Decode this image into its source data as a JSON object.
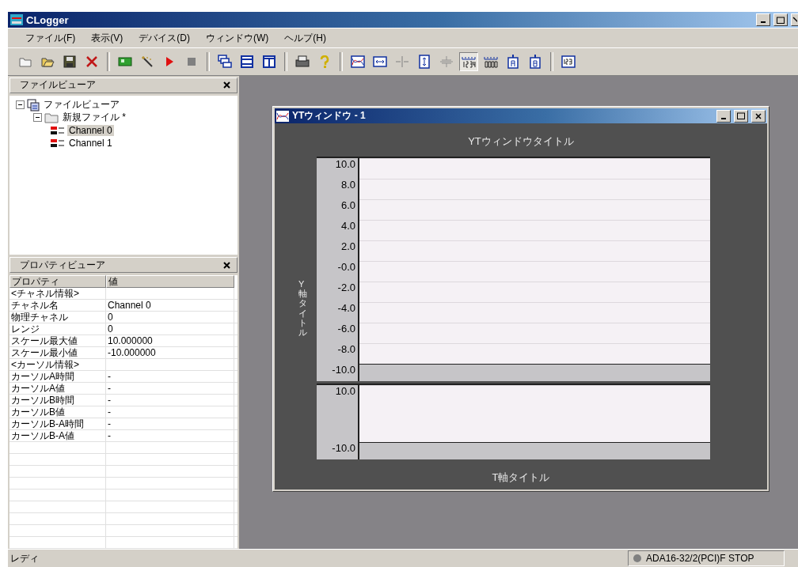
{
  "window": {
    "title": "CLogger"
  },
  "menu": [
    "ファイル(F)",
    "表示(V)",
    "デバイス(D)",
    "ウィンドウ(W)",
    "ヘルプ(H)"
  ],
  "toolbar": [
    [
      {
        "kind": "new",
        "pressed": false
      },
      {
        "kind": "open",
        "pressed": false
      },
      {
        "kind": "save",
        "pressed": false
      },
      {
        "kind": "delete",
        "pressed": false
      }
    ],
    [
      {
        "kind": "device",
        "pressed": false
      },
      {
        "kind": "wand",
        "pressed": false
      },
      {
        "kind": "play",
        "pressed": false
      },
      {
        "kind": "stop",
        "pressed": false
      }
    ],
    [
      {
        "kind": "cascade",
        "pressed": false
      },
      {
        "kind": "tileh",
        "pressed": false
      },
      {
        "kind": "tilev",
        "pressed": false
      }
    ],
    [
      {
        "kind": "print",
        "pressed": false
      },
      {
        "kind": "help",
        "pressed": false
      }
    ],
    [
      {
        "kind": "wave",
        "pressed": false
      },
      {
        "kind": "hfit",
        "pressed": false
      },
      {
        "kind": "hshrink",
        "pressed": false
      },
      {
        "kind": "vfit",
        "pressed": false
      },
      {
        "kind": "vshrink",
        "pressed": false
      },
      {
        "kind": "digits",
        "pressed": true
      },
      {
        "kind": "zeros",
        "pressed": false
      },
      {
        "kind": "cursora",
        "pressed": false
      },
      {
        "kind": "cursorb",
        "pressed": false
      }
    ],
    [
      {
        "kind": "numeric",
        "pressed": false
      }
    ]
  ],
  "file_viewer": {
    "title": "ファイルビューア",
    "tree": [
      {
        "label": "ファイルビューア",
        "kind": "root",
        "expanded": true,
        "selected": false,
        "children": [
          {
            "label": "新規ファイル *",
            "kind": "file",
            "expanded": true,
            "selected": false,
            "children": [
              {
                "label": "Channel 0",
                "kind": "channel",
                "selected": true
              },
              {
                "label": "Channel 1",
                "kind": "channel",
                "selected": false
              }
            ]
          }
        ]
      }
    ]
  },
  "property_viewer": {
    "title": "プロパティビューア",
    "columns": [
      "プロパティ",
      "値"
    ],
    "rows": [
      {
        "property": "<チャネル情報>"
      },
      {
        "property": "チャネル名",
        "value": "Channel 0"
      },
      {
        "property": "物理チャネル",
        "value": "0"
      },
      {
        "property": "レンジ",
        "value": "0"
      },
      {
        "property": "スケール最大値",
        "value": "10.000000"
      },
      {
        "property": "スケール最小値",
        "value": "-10.000000"
      },
      {
        "property": "<カーソル情報>"
      },
      {
        "property": "カーソルA時間",
        "value": "-"
      },
      {
        "property": "カーソルA値",
        "value": "-"
      },
      {
        "property": "カーソルB時間",
        "value": "-"
      },
      {
        "property": "カーソルB値",
        "value": "-"
      },
      {
        "property": "カーソルB-A時間",
        "value": "-"
      },
      {
        "property": "カーソルB-A値",
        "value": "-"
      }
    ]
  },
  "yt_window": {
    "title": "YTウィンドウ - 1",
    "chart_title": "YTウィンドウタイトル",
    "y_axis_title": "Y軸タイトル",
    "t_axis_title": "T軸タイトル",
    "upper_plot_ticks": [
      "10.0",
      "8.0",
      "6.0",
      "4.0",
      "2.0",
      "-0.0",
      "-2.0",
      "-4.0",
      "-6.0",
      "-8.0",
      "-10.0"
    ],
    "lower_plot_ticks": [
      "10.0",
      "-10.0"
    ]
  },
  "status_bar": {
    "message": "レディ",
    "device": "ADA16-32/2(PCI)F STOP"
  }
}
